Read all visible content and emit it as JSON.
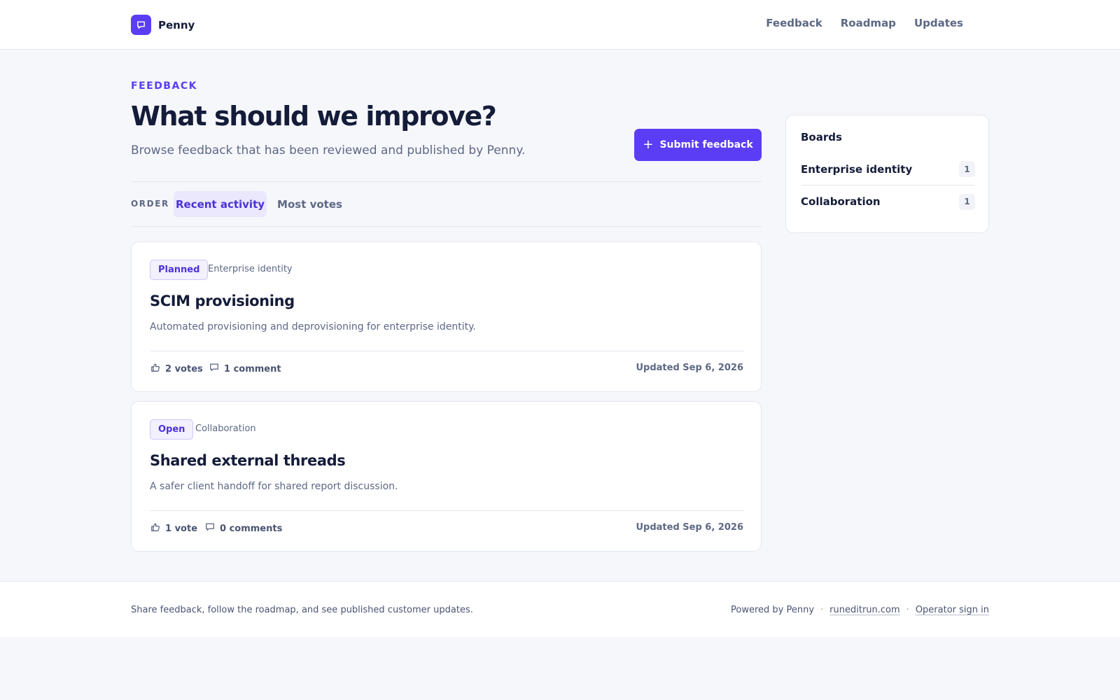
{
  "header": {
    "brand": "Penny",
    "nav": [
      "Feedback",
      "Roadmap",
      "Updates"
    ]
  },
  "page": {
    "eyebrow": "FEEDBACK",
    "title": "What should we improve?",
    "subtitle": "Browse feedback that has been reviewed and published by Penny.",
    "submit_label": "Submit feedback"
  },
  "order": {
    "label": "ORDER",
    "options": [
      "Recent activity",
      "Most votes"
    ],
    "selected": "Recent activity"
  },
  "posts": [
    {
      "status": "Planned",
      "board": "Enterprise identity",
      "title": "SCIM provisioning",
      "description": "Automated provisioning and deprovisioning for enterprise identity.",
      "votes": "2 votes",
      "comments": "1 comment",
      "updated": "Updated Sep 6, 2026"
    },
    {
      "status": "Open",
      "board": "Collaboration",
      "title": "Shared external threads",
      "description": "A safer client handoff for shared report discussion.",
      "votes": "1 vote",
      "comments": "0 comments",
      "updated": "Updated Sep 6, 2026"
    }
  ],
  "sidebar": {
    "heading": "Boards",
    "boards": [
      {
        "name": "Enterprise identity",
        "count": "1"
      },
      {
        "name": "Collaboration",
        "count": "1"
      }
    ]
  },
  "footer": {
    "tagline": "Share feedback, follow the roadmap, and see published customer updates.",
    "powered": "Powered by Penny",
    "separator": "·",
    "site_link": "runeditrun.com",
    "signin_link": "Operator sign in"
  },
  "colors": {
    "accent": "#5b3df5",
    "background": "#f6f7fb",
    "text": "#141c3a",
    "muted": "#5d6885"
  },
  "icons": {
    "brand": "chat-bubble-icon",
    "submit": "plus-icon",
    "votes": "thumbs-up-icon",
    "comments": "comment-icon"
  }
}
